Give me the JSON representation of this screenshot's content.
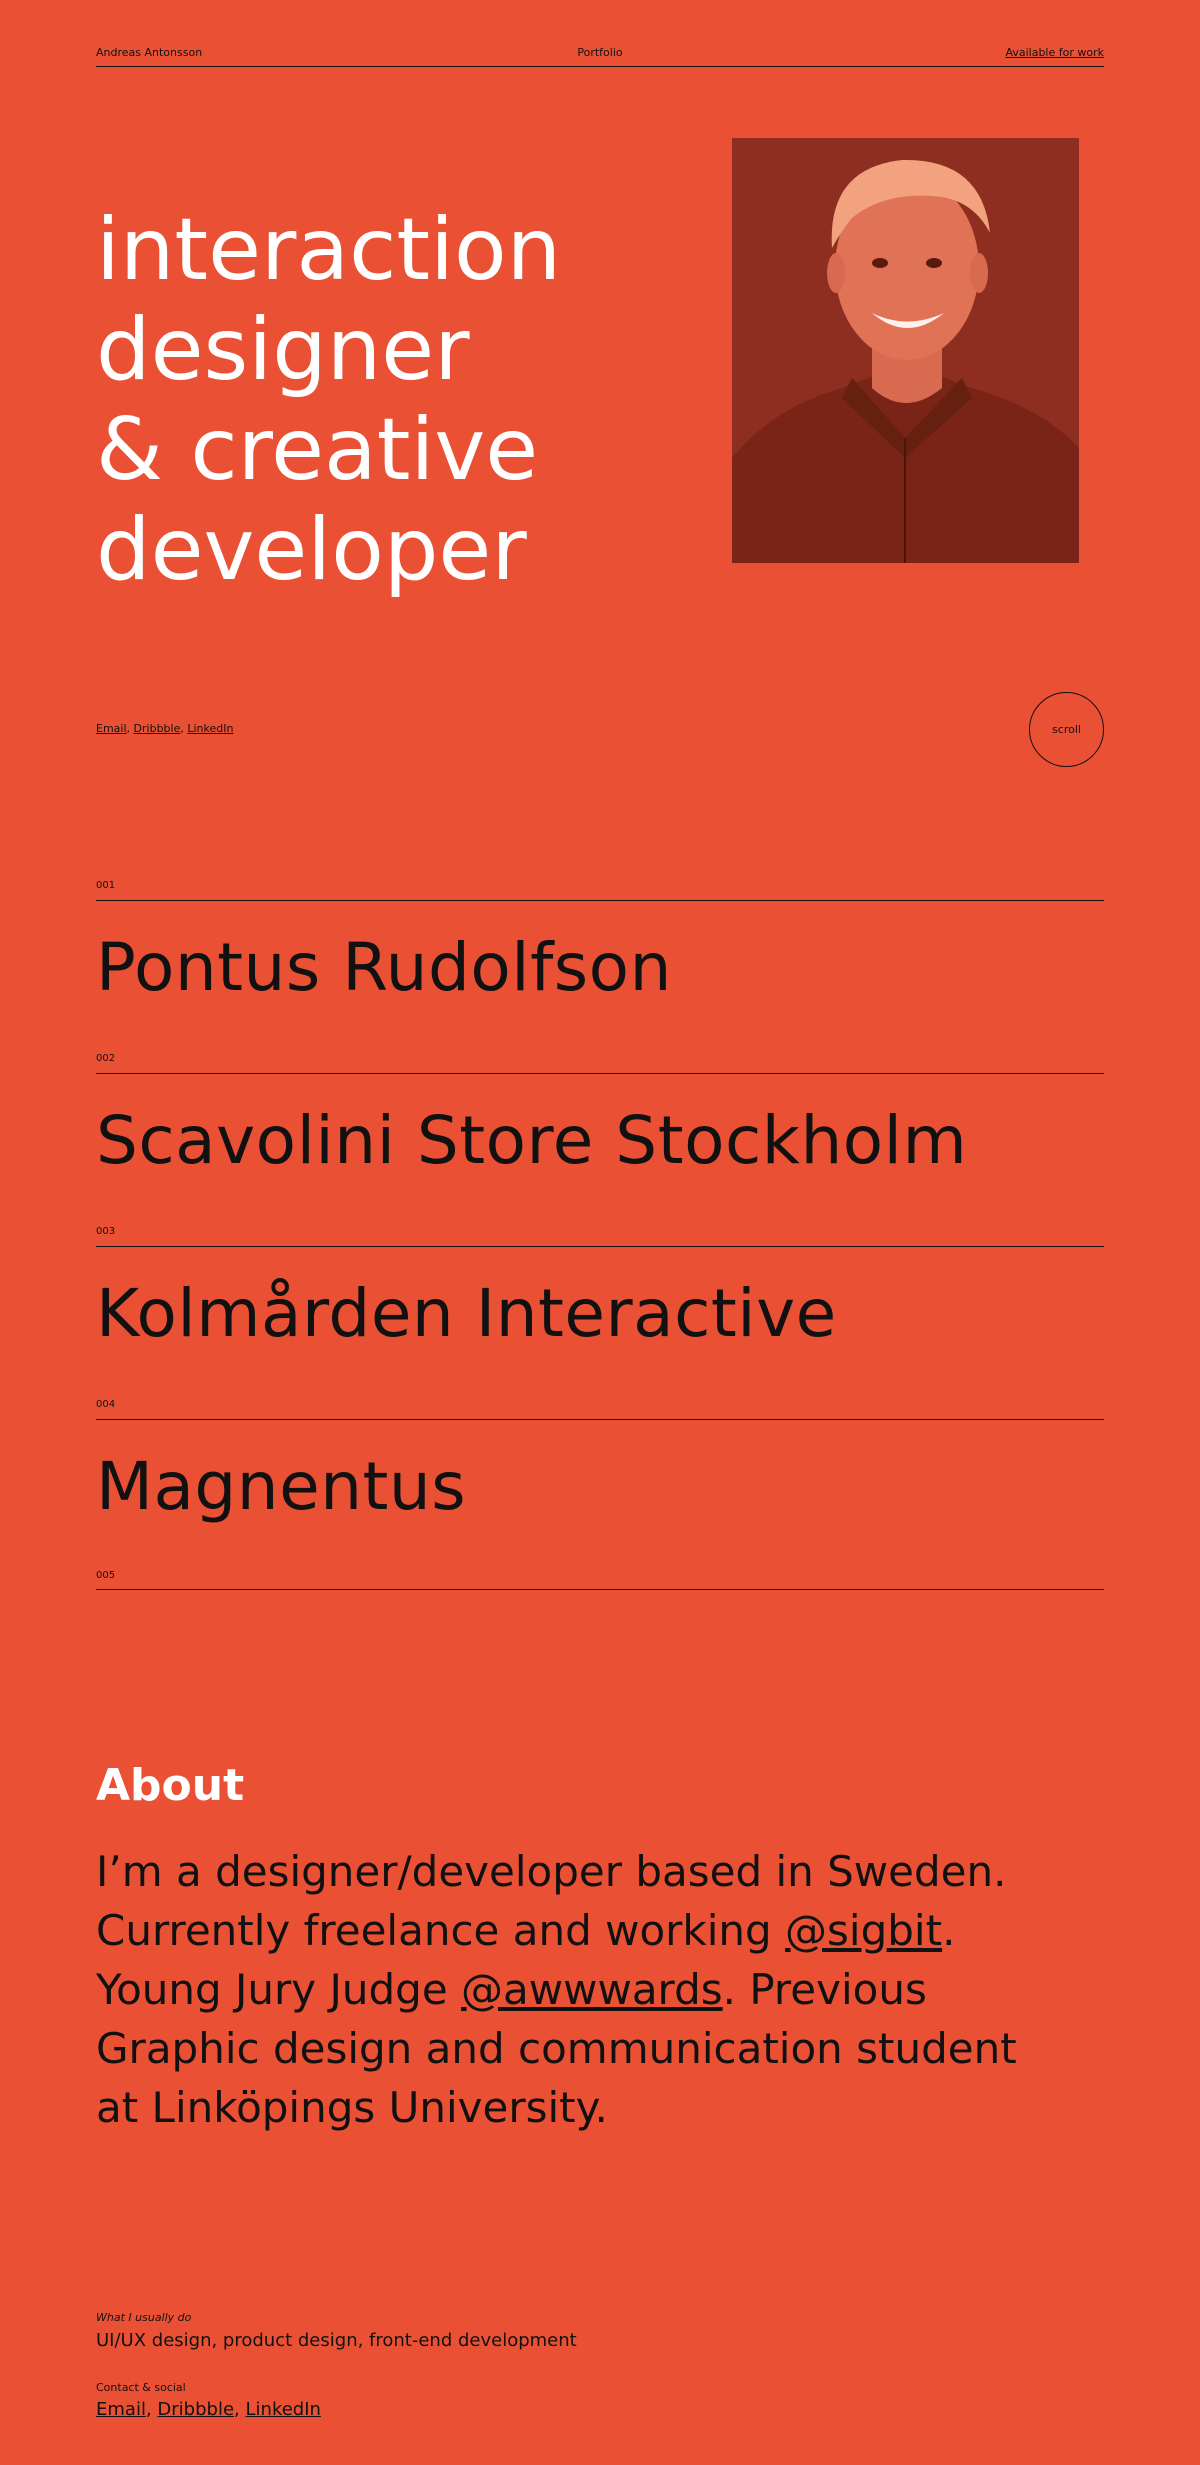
{
  "header": {
    "name": "Andreas Antonsson",
    "nav": "Portfolio",
    "availability": "Available for work"
  },
  "hero": {
    "lines": [
      "interaction",
      "designer",
      "& creative",
      "developer"
    ]
  },
  "social": {
    "email": "Email",
    "dribbble": "Dribbble",
    "linkedin": "LinkedIn",
    "separator": ","
  },
  "scroll_label": "scroll",
  "projects": [
    {
      "num": "001",
      "name": "Pontus Rudolfson"
    },
    {
      "num": "002",
      "name": "Scavolini Store Stockholm"
    },
    {
      "num": "003",
      "name": "Kolmården Interactive"
    },
    {
      "num": "004",
      "name": "Magnentus"
    }
  ],
  "projects_end_num": "005",
  "about": {
    "heading": "About",
    "text_1": "I’m a designer/developer based in Sweden. Currently freelance and working ",
    "link_sigbit": "@sigbit",
    "text_2": ". Young Jury Judge ",
    "link_awwwards": "@awwwards",
    "text_3": ". Previous Graphic design and communication student at Linköpings University.",
    "what_label": "What I usually do",
    "what_value": "UI/UX design, product design, front-end development",
    "contact_label": "Contact & social"
  },
  "colors": {
    "background": "#ea5134",
    "text": "#111111",
    "hero_text": "#ffffff",
    "portrait_bg": "#8e2e20"
  },
  "icons": {
    "portrait": "person-photo"
  }
}
